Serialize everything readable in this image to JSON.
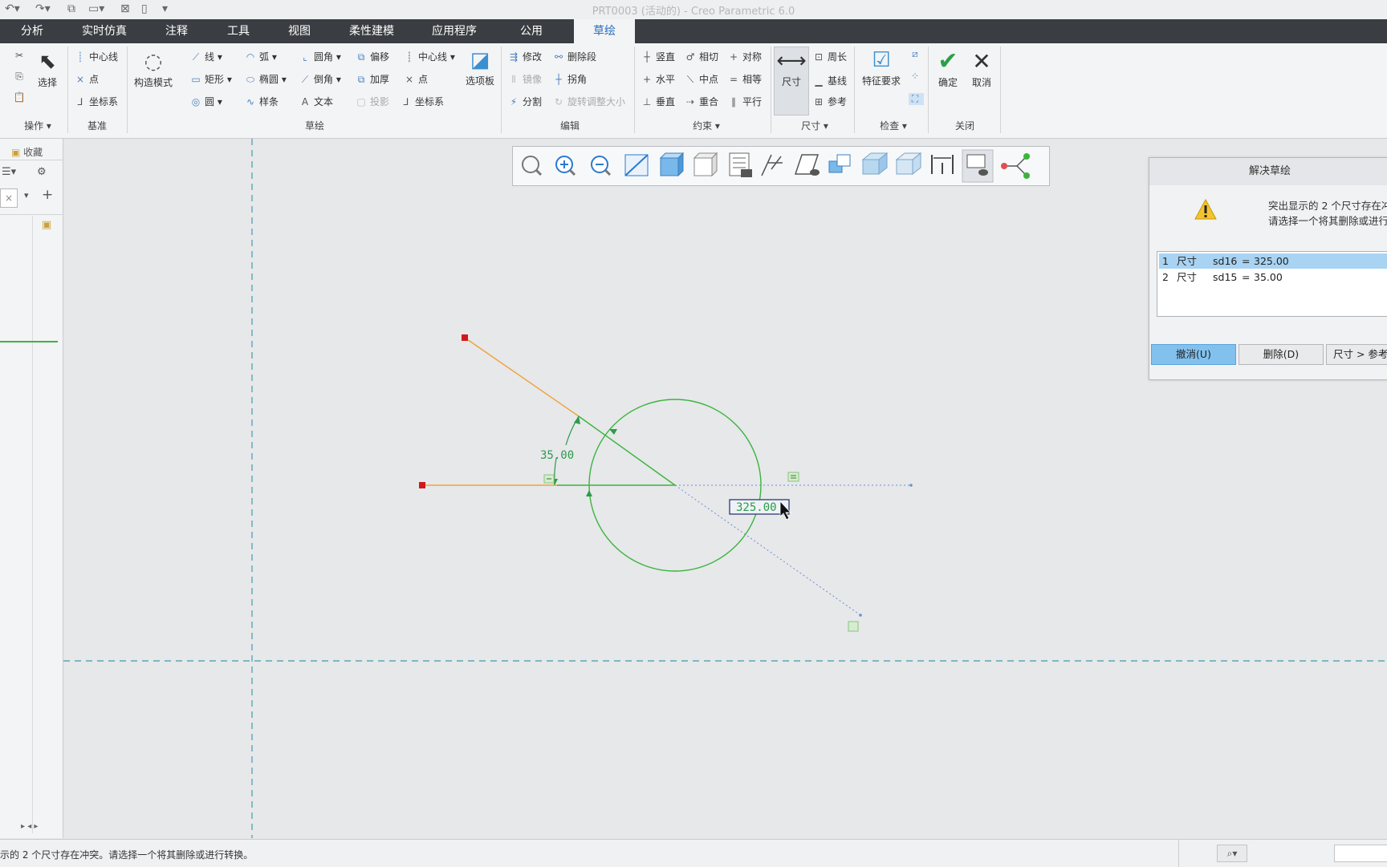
{
  "app": {
    "title": "PRT0003 (活动的) - Creo Parametric 6.0"
  },
  "tabs": [
    {
      "label": "分析"
    },
    {
      "label": "实时仿真"
    },
    {
      "label": "注释"
    },
    {
      "label": "工具"
    },
    {
      "label": "视图"
    },
    {
      "label": "柔性建模"
    },
    {
      "label": "应用程序"
    },
    {
      "label": "公用"
    },
    {
      "label": "草绘",
      "active": true
    }
  ],
  "ribbon": {
    "operations": {
      "select": "选择",
      "group": "操作"
    },
    "datum": {
      "centerline": "中心线",
      "point": "点",
      "csys": "坐标系",
      "group": "基准"
    },
    "sketch": {
      "construction_mode": "构造模式",
      "line": "线",
      "rectangle": "矩形",
      "circle": "圆",
      "arc": "弧",
      "ellipse": "椭圆",
      "spline": "样条",
      "fillet": "圆角",
      "chamfer": "倒角",
      "text": "文本",
      "offset": "偏移",
      "thicken": "加厚",
      "project": "投影",
      "centerline": "中心线",
      "point": "点",
      "csys": "坐标系",
      "palette": "选项板",
      "group": "草绘"
    },
    "edit": {
      "modify": "修改",
      "delete_segment": "删除段",
      "mirror": "镜像",
      "corner": "拐角",
      "divide": "分割",
      "rotate_resize": "旋转调整大小",
      "group": "编辑"
    },
    "constrain": {
      "vertical": "竖直",
      "tangent": "相切",
      "symmetric": "对称",
      "horizontal": "水平",
      "midpoint": "中点",
      "equal": "相等",
      "perpendicular": "垂直",
      "coincident": "重合",
      "parallel": "平行",
      "group": "约束"
    },
    "dimension": {
      "dimension": "尺寸",
      "perimeter": "周长",
      "baseline": "基线",
      "reference": "参考",
      "group": "尺寸"
    },
    "inspect": {
      "feature_requirements": "特征要求",
      "group": "检查"
    },
    "close": {
      "ok": "确定",
      "cancel": "取消",
      "group": "关闭"
    }
  },
  "left_panel": {
    "favorites": "收藏"
  },
  "sketch": {
    "angle_dim": "35.00",
    "angle_dim2": "325.00",
    "colors": {
      "line": "#f0a23a",
      "geom": "#3cb43c",
      "dim": "#2e9a4a",
      "endpoint": "#d0181c",
      "ref": "#6f8fd2"
    }
  },
  "dialog": {
    "title": "解决草绘",
    "message_line1": "突出显示的 2 个尺寸存在冲",
    "message_line2": "请选择一个将其删除或进行",
    "rows": [
      {
        "index": "1",
        "type": "尺寸",
        "name": "sd16",
        "eq": "=",
        "value": "325.00"
      },
      {
        "index": "2",
        "type": "尺寸",
        "name": "sd15",
        "eq": "=",
        "value": "35.00"
      }
    ],
    "buttons": {
      "undo": "撤消(U)",
      "delete": "删除(D)",
      "convert": "尺寸 > 参考"
    }
  },
  "status": {
    "message": "示的 2 个尺寸存在冲突。请选择一个将其删除或进行转换。"
  }
}
